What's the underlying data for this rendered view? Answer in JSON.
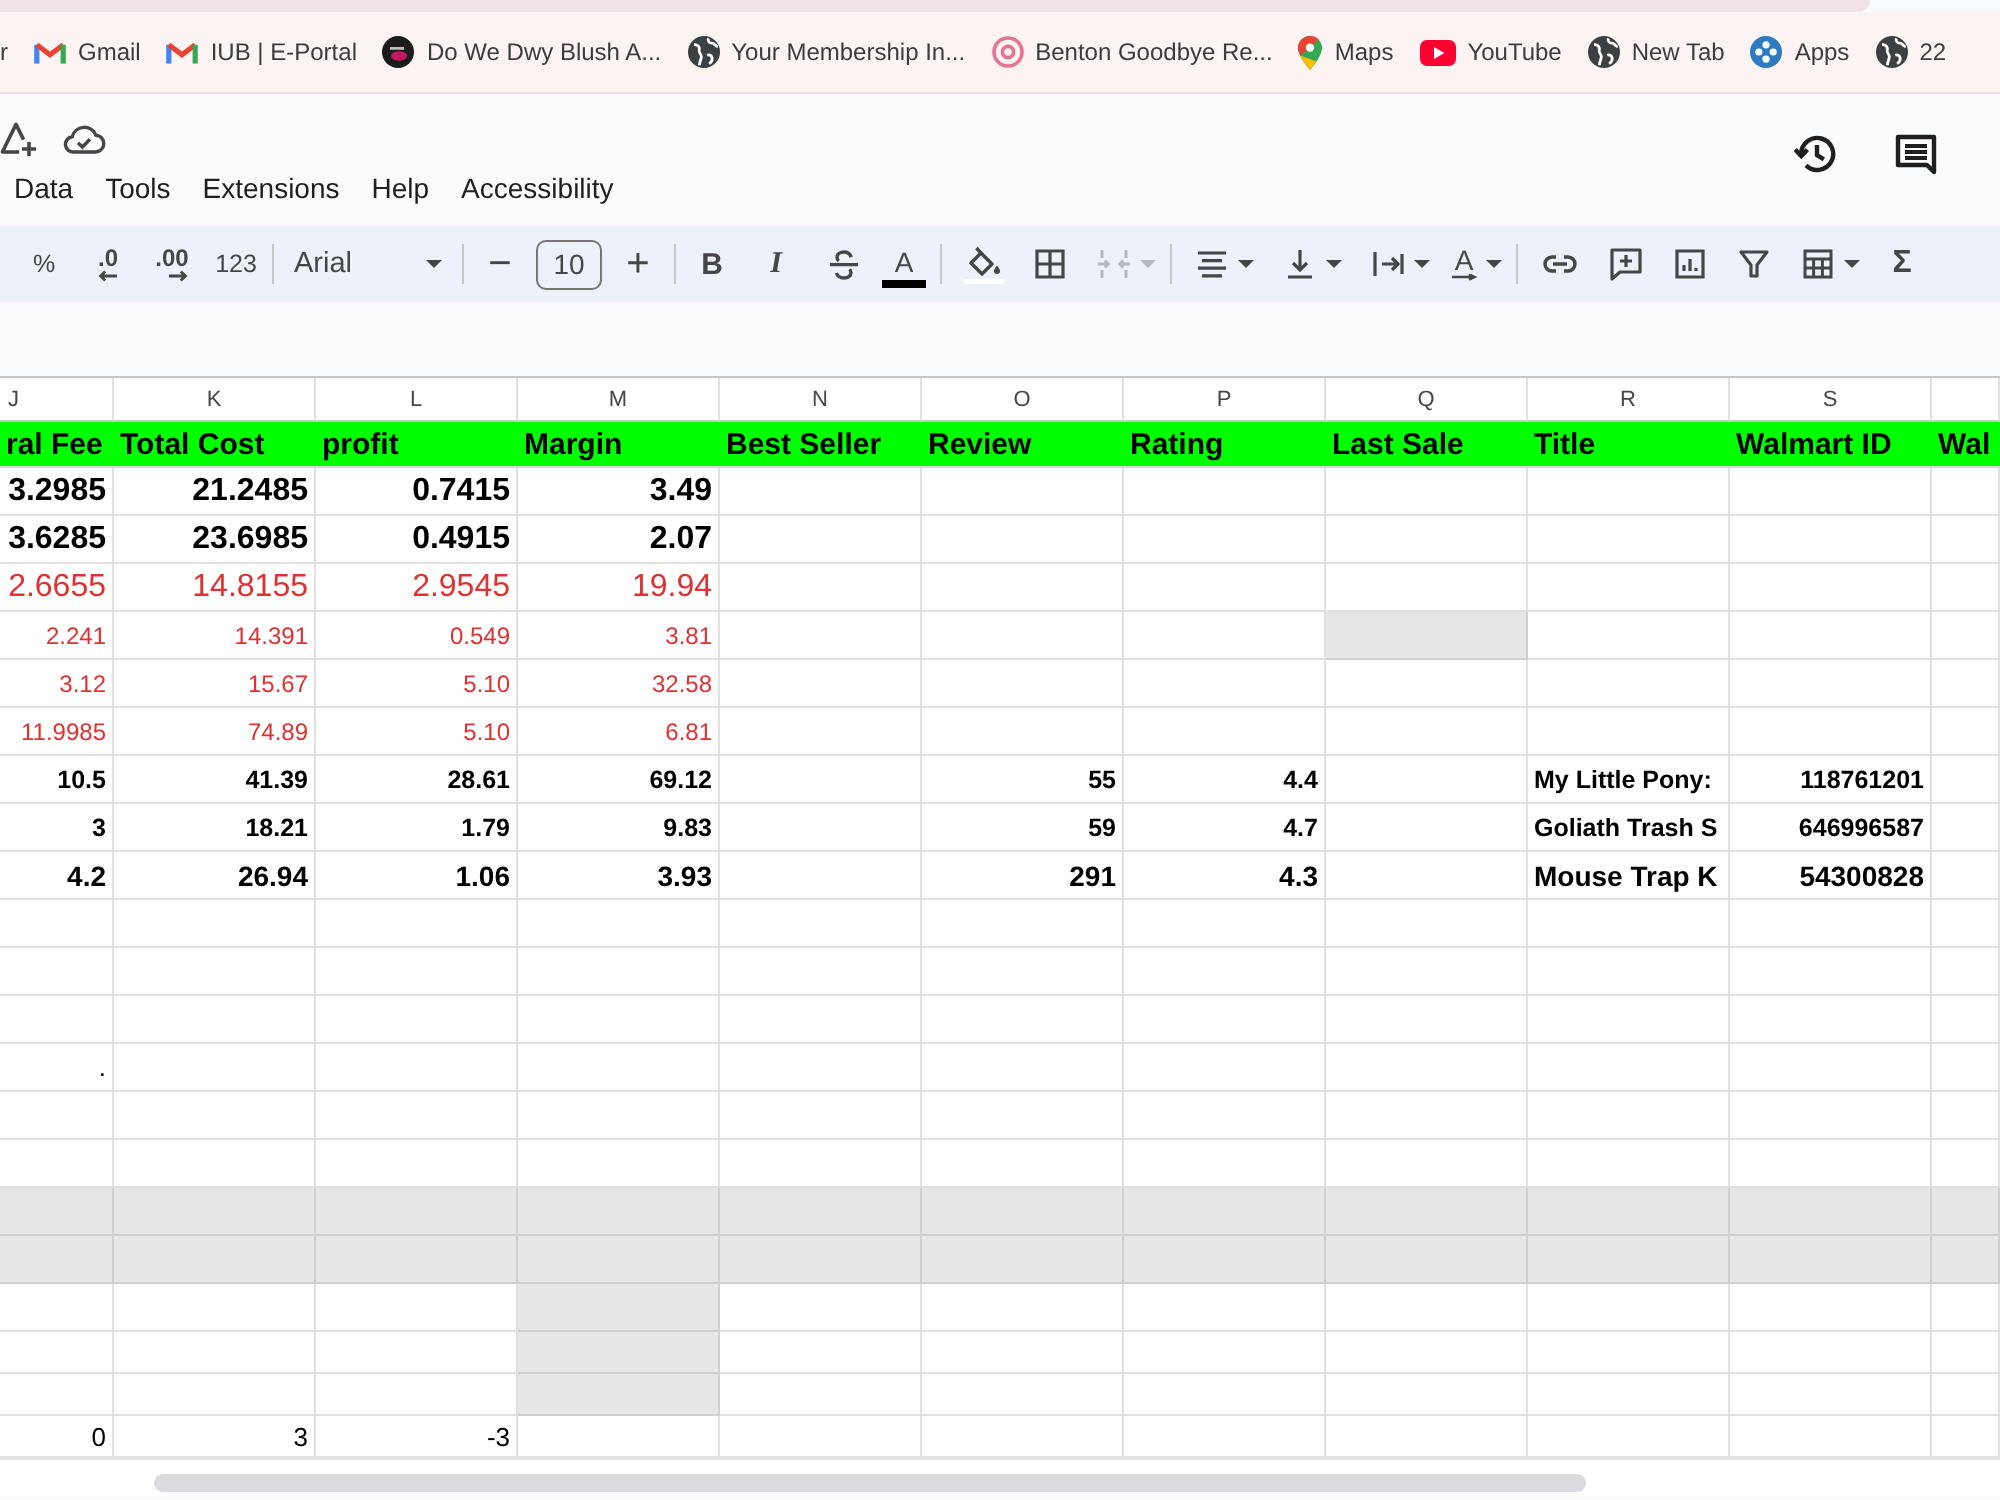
{
  "bookmarks": [
    {
      "label": "r"
    },
    {
      "kind": "mail",
      "label": "Gmail"
    },
    {
      "kind": "mail",
      "label": "IUB | E-Portal"
    },
    {
      "kind": "thumb",
      "label": "Do We Dwy Blush A..."
    },
    {
      "kind": "globe",
      "label": "Your Membership In..."
    },
    {
      "kind": "swirl",
      "label": "Benton Goodbye Re..."
    },
    {
      "kind": "pin",
      "label": "Maps"
    },
    {
      "kind": "play",
      "label": "YouTube"
    },
    {
      "kind": "globe",
      "label": "New Tab"
    },
    {
      "kind": "apps",
      "label": "Apps"
    },
    {
      "kind": "globe",
      "label": "22"
    }
  ],
  "menu": [
    "Data",
    "Tools",
    "Extensions",
    "Help",
    "Accessibility"
  ],
  "toolbar": [
    [
      {
        "kind": "format",
        "label": "%",
        "disabled": false
      },
      {
        "kind": "decimal-decrease",
        "label": ".0",
        "disabled": false
      },
      {
        "kind": "decimal-increase",
        "label": ".00",
        "disabled": false
      },
      {
        "kind": "format",
        "label": "123",
        "disabled": false
      }
    ],
    [
      {
        "kind": "font",
        "label": "Arial",
        "disabled": false
      }
    ],
    [
      {
        "kind": "decrease",
        "label": "−",
        "disabled": false
      },
      {
        "kind": "size",
        "label": "10",
        "disabled": false
      },
      {
        "kind": "increase",
        "label": "+",
        "disabled": false
      }
    ],
    [
      {
        "kind": "bold",
        "label": "B",
        "disabled": false
      },
      {
        "kind": "italic",
        "label": "I",
        "disabled": false
      },
      {
        "kind": "strikethrough",
        "disabled": false
      },
      {
        "kind": "text-color",
        "label": "A",
        "disabled": false
      }
    ],
    [
      {
        "kind": "fill-color",
        "disabled": false
      },
      {
        "kind": "borders",
        "disabled": false
      },
      {
        "kind": "merge",
        "disabled": true
      }
    ],
    [
      {
        "kind": "align",
        "disabled": false
      },
      {
        "kind": "valign",
        "disabled": false
      },
      {
        "kind": "wrap",
        "disabled": false
      },
      {
        "kind": "rotate",
        "label": "A",
        "disabled": false
      }
    ],
    [
      {
        "kind": "link",
        "disabled": false
      },
      {
        "kind": "comment",
        "disabled": false
      },
      {
        "kind": "chart",
        "disabled": false
      },
      {
        "kind": "filter",
        "disabled": false
      },
      {
        "kind": "table",
        "disabled": false
      },
      {
        "kind": "sum",
        "label": "Σ",
        "disabled": false
      }
    ]
  ],
  "columns": [
    {
      "letter": "J",
      "kind": "number"
    },
    {
      "letter": "K",
      "kind": "number"
    },
    {
      "letter": "L",
      "kind": "number"
    },
    {
      "letter": "M",
      "kind": "number"
    },
    {
      "letter": "N",
      "kind": "number"
    },
    {
      "letter": "O",
      "kind": "number"
    },
    {
      "letter": "P",
      "kind": "number"
    },
    {
      "letter": "Q",
      "kind": "number"
    },
    {
      "letter": "R",
      "kind": "text"
    },
    {
      "letter": "S",
      "kind": "number"
    }
  ],
  "header_row": [
    "ral Fee",
    "Total Cost",
    "profit",
    "Margin",
    "Best Seller",
    "Review",
    "Rating",
    "Last Sale",
    "Title",
    "Walmart ID",
    "Wal"
  ],
  "rows": [
    {
      "kind": "bold-large",
      "cells": [
        {
          "text": "3.2985",
          "shaded": false
        },
        {
          "text": "21.2485",
          "shaded": false
        },
        {
          "text": "0.7415",
          "shaded": false
        },
        {
          "text": "3.49",
          "shaded": false
        },
        {
          "shaded": false
        },
        {
          "shaded": false
        },
        {
          "shaded": false
        },
        {
          "shaded": false
        },
        {
          "shaded": false
        },
        {
          "shaded": false
        },
        {
          "shaded": false
        }
      ]
    },
    {
      "kind": "bold-large",
      "cells": [
        {
          "text": "3.6285",
          "shaded": false
        },
        {
          "text": "23.6985",
          "shaded": false
        },
        {
          "text": "0.4915",
          "shaded": false
        },
        {
          "text": "2.07",
          "shaded": false
        },
        {
          "shaded": false
        },
        {
          "shaded": false
        },
        {
          "shaded": false
        },
        {
          "shaded": false
        },
        {
          "shaded": false
        },
        {
          "shaded": false
        },
        {
          "shaded": false
        }
      ]
    },
    {
      "kind": "red-large",
      "cells": [
        {
          "text": "2.6655",
          "shaded": false
        },
        {
          "text": "14.8155",
          "shaded": false
        },
        {
          "text": "2.9545",
          "shaded": false
        },
        {
          "text": "19.94",
          "shaded": false
        },
        {
          "shaded": false
        },
        {
          "shaded": false
        },
        {
          "shaded": false
        },
        {
          "shaded": false
        },
        {
          "shaded": false
        },
        {
          "shaded": false
        },
        {
          "shaded": false
        }
      ]
    },
    {
      "kind": "red",
      "cells": [
        {
          "text": "2.241",
          "shaded": false
        },
        {
          "text": "14.391",
          "shaded": false
        },
        {
          "text": "0.549",
          "shaded": false
        },
        {
          "text": "3.81",
          "shaded": false
        },
        {
          "shaded": false
        },
        {
          "shaded": false
        },
        {
          "shaded": false
        },
        {
          "shaded": true
        },
        {
          "shaded": false
        },
        {
          "shaded": false
        },
        {
          "shaded": false
        }
      ]
    },
    {
      "kind": "red",
      "cells": [
        {
          "text": "3.12",
          "shaded": false
        },
        {
          "text": "15.67",
          "shaded": false
        },
        {
          "text": "5.10",
          "shaded": false
        },
        {
          "text": "32.58",
          "shaded": false
        },
        {
          "shaded": false
        },
        {
          "shaded": false
        },
        {
          "shaded": false
        },
        {
          "shaded": false
        },
        {
          "shaded": false
        },
        {
          "shaded": false
        },
        {
          "shaded": false
        }
      ]
    },
    {
      "kind": "red",
      "cells": [
        {
          "text": "11.9985",
          "shaded": false
        },
        {
          "text": "74.89",
          "shaded": false
        },
        {
          "text": "5.10",
          "shaded": false
        },
        {
          "text": "6.81",
          "shaded": false
        },
        {
          "shaded": false
        },
        {
          "shaded": false
        },
        {
          "shaded": false
        },
        {
          "shaded": false
        },
        {
          "shaded": false
        },
        {
          "shaded": false
        },
        {
          "shaded": false
        }
      ]
    },
    {
      "kind": "bold-small",
      "cells": [
        {
          "text": "10.5",
          "shaded": false
        },
        {
          "text": "41.39",
          "shaded": false
        },
        {
          "text": "28.61",
          "shaded": false
        },
        {
          "text": "69.12",
          "shaded": false
        },
        {
          "shaded": false
        },
        {
          "text": "55",
          "shaded": false
        },
        {
          "text": "4.4",
          "shaded": false
        },
        {
          "shaded": false
        },
        {
          "text": "My Little Pony:",
          "shaded": false
        },
        {
          "text": "118761201",
          "shaded": false
        },
        {
          "shaded": false
        }
      ]
    },
    {
      "kind": "bold-small",
      "cells": [
        {
          "text": "3",
          "shaded": false
        },
        {
          "text": "18.21",
          "shaded": false
        },
        {
          "text": "1.79",
          "shaded": false
        },
        {
          "text": "9.83",
          "shaded": false
        },
        {
          "shaded": false
        },
        {
          "text": "59",
          "shaded": false
        },
        {
          "text": "4.7",
          "shaded": false
        },
        {
          "shaded": false
        },
        {
          "text": "Goliath Trash S",
          "shaded": false
        },
        {
          "text": "646996587",
          "shaded": false
        },
        {
          "shaded": false
        }
      ]
    },
    {
      "kind": "bold",
      "cells": [
        {
          "text": "4.2",
          "shaded": false
        },
        {
          "text": "26.94",
          "shaded": false
        },
        {
          "text": "1.06",
          "shaded": false
        },
        {
          "text": "3.93",
          "shaded": false
        },
        {
          "shaded": false
        },
        {
          "text": "291",
          "shaded": false
        },
        {
          "text": "4.3",
          "shaded": false
        },
        {
          "shaded": false
        },
        {
          "text": "Mouse Trap K",
          "shaded": false
        },
        {
          "text": "54300828",
          "shaded": false
        },
        {
          "shaded": false
        }
      ]
    },
    {
      "kind": "plain",
      "cells": [
        {
          "shaded": false
        },
        {
          "shaded": false
        },
        {
          "shaded": false
        },
        {
          "shaded": false
        },
        {
          "shaded": false
        },
        {
          "shaded": false
        },
        {
          "shaded": false
        },
        {
          "shaded": false
        },
        {
          "shaded": false
        },
        {
          "shaded": false
        },
        {
          "shaded": false
        }
      ]
    },
    {
      "kind": "plain",
      "cells": [
        {
          "shaded": false
        },
        {
          "shaded": false
        },
        {
          "shaded": false
        },
        {
          "shaded": false
        },
        {
          "shaded": false
        },
        {
          "shaded": false
        },
        {
          "shaded": false
        },
        {
          "shaded": false
        },
        {
          "shaded": false
        },
        {
          "shaded": false
        },
        {
          "shaded": false
        }
      ]
    },
    {
      "kind": "plain",
      "cells": [
        {
          "shaded": false
        },
        {
          "shaded": false
        },
        {
          "shaded": false
        },
        {
          "shaded": false
        },
        {
          "shaded": false
        },
        {
          "shaded": false
        },
        {
          "shaded": false
        },
        {
          "shaded": false
        },
        {
          "shaded": false
        },
        {
          "shaded": false
        },
        {
          "shaded": false
        }
      ]
    },
    {
      "kind": "plain",
      "cells": [
        {
          "text": ".",
          "shaded": false
        },
        {
          "shaded": false
        },
        {
          "shaded": false
        },
        {
          "shaded": false
        },
        {
          "shaded": false
        },
        {
          "shaded": false
        },
        {
          "shaded": false
        },
        {
          "shaded": false
        },
        {
          "shaded": false
        },
        {
          "shaded": false
        },
        {
          "shaded": false
        }
      ]
    },
    {
      "kind": "plain",
      "cells": [
        {
          "shaded": false
        },
        {
          "shaded": false
        },
        {
          "shaded": false
        },
        {
          "shaded": false
        },
        {
          "shaded": false
        },
        {
          "shaded": false
        },
        {
          "shaded": false
        },
        {
          "shaded": false
        },
        {
          "shaded": false
        },
        {
          "shaded": false
        },
        {
          "shaded": false
        }
      ]
    },
    {
      "kind": "plain",
      "cells": [
        {
          "shaded": false
        },
        {
          "shaded": false
        },
        {
          "shaded": false
        },
        {
          "shaded": false
        },
        {
          "shaded": false
        },
        {
          "shaded": false
        },
        {
          "shaded": false
        },
        {
          "shaded": false
        },
        {
          "shaded": false
        },
        {
          "shaded": false
        },
        {
          "shaded": false
        }
      ]
    },
    {
      "kind": "plain",
      "cells": [
        {
          "shaded": true
        },
        {
          "shaded": true
        },
        {
          "shaded": true
        },
        {
          "shaded": true
        },
        {
          "shaded": true
        },
        {
          "shaded": true
        },
        {
          "shaded": true
        },
        {
          "shaded": true
        },
        {
          "shaded": true
        },
        {
          "shaded": true
        },
        {
          "shaded": true
        }
      ]
    },
    {
      "kind": "plain",
      "cells": [
        {
          "shaded": true
        },
        {
          "shaded": true
        },
        {
          "shaded": true
        },
        {
          "shaded": true
        },
        {
          "shaded": true
        },
        {
          "shaded": true
        },
        {
          "shaded": true
        },
        {
          "shaded": true
        },
        {
          "shaded": true
        },
        {
          "shaded": true
        },
        {
          "shaded": true
        }
      ]
    },
    {
      "kind": "plain",
      "cells": [
        {
          "shaded": false
        },
        {
          "shaded": false
        },
        {
          "shaded": false
        },
        {
          "shaded": true
        },
        {
          "shaded": false
        },
        {
          "shaded": false
        },
        {
          "shaded": false
        },
        {
          "shaded": false
        },
        {
          "shaded": false
        },
        {
          "shaded": false
        },
        {
          "shaded": false
        }
      ]
    },
    {
      "kind": "plain",
      "cells": [
        {
          "shaded": false
        },
        {
          "shaded": false
        },
        {
          "shaded": false
        },
        {
          "shaded": true
        },
        {
          "shaded": false
        },
        {
          "shaded": false
        },
        {
          "shaded": false
        },
        {
          "shaded": false
        },
        {
          "shaded": false
        },
        {
          "shaded": false
        },
        {
          "shaded": false
        }
      ]
    },
    {
      "kind": "plain",
      "cells": [
        {
          "shaded": false
        },
        {
          "shaded": false
        },
        {
          "shaded": false
        },
        {
          "shaded": true
        },
        {
          "shaded": false
        },
        {
          "shaded": false
        },
        {
          "shaded": false
        },
        {
          "shaded": false
        },
        {
          "shaded": false
        },
        {
          "shaded": false
        },
        {
          "shaded": false
        }
      ]
    },
    {
      "kind": "plain",
      "cells": [
        {
          "text": "0",
          "shaded": false
        },
        {
          "text": "3",
          "shaded": false
        },
        {
          "text": "-3",
          "shaded": false
        },
        {
          "shaded": false
        },
        {
          "shaded": false
        },
        {
          "shaded": false
        },
        {
          "shaded": false
        },
        {
          "shaded": false
        },
        {
          "shaded": false
        },
        {
          "shaded": false
        },
        {
          "shaded": false
        }
      ]
    }
  ]
}
